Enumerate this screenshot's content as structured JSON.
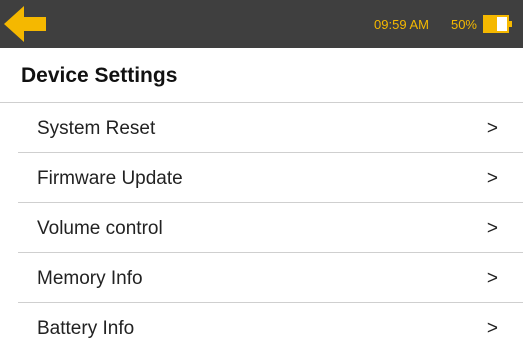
{
  "status_bar": {
    "back_icon": "arrow-left-icon",
    "time": "09:59 AM",
    "battery_percent": "50%",
    "battery_icon": "battery-half-icon",
    "accent_color": "#f5b800",
    "background_color": "#3f3f3f"
  },
  "header": {
    "title": "Device Settings"
  },
  "menu": {
    "items": [
      {
        "label": "System Reset",
        "chevron": ">"
      },
      {
        "label": "Firmware Update",
        "chevron": ">"
      },
      {
        "label": "Volume control",
        "chevron": ">"
      },
      {
        "label": "Memory Info",
        "chevron": ">"
      },
      {
        "label": "Battery Info",
        "chevron": ">"
      }
    ]
  }
}
